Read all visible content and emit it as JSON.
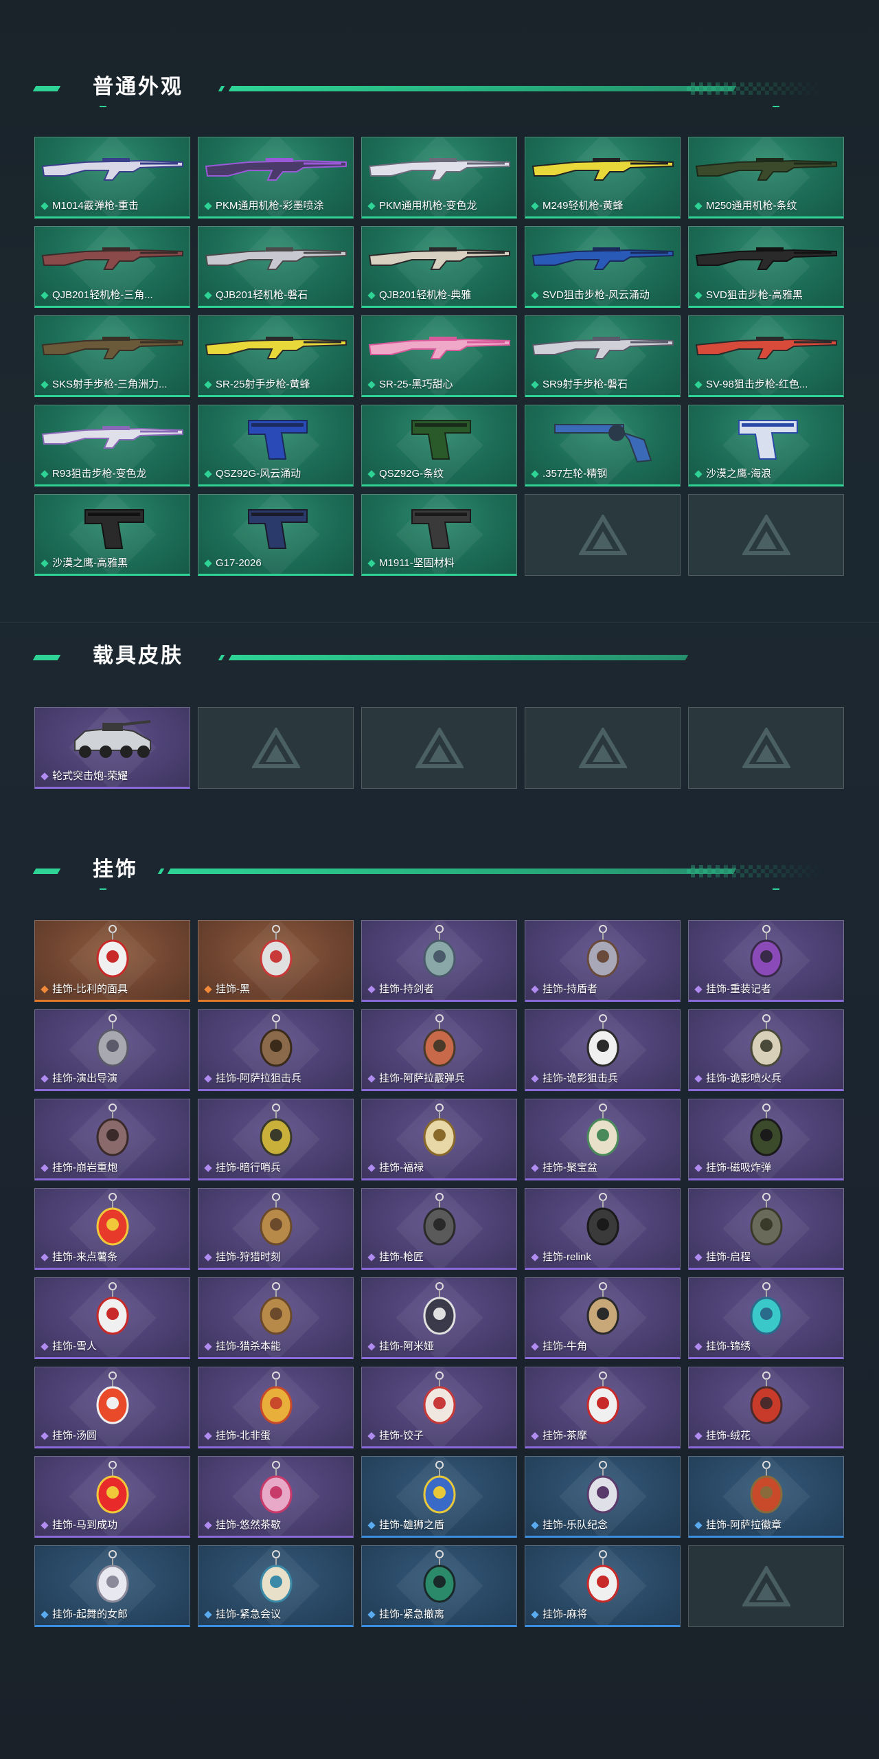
{
  "sections": [
    {
      "title": "普通外观",
      "items": [
        {
          "label": "M1014霰弹枪-重击",
          "rarity": "green",
          "kind": "rifle",
          "colors": [
            "#d8d8e8",
            "#3a3f8a"
          ]
        },
        {
          "label": "PKM通用机枪-彩墨喷涂",
          "rarity": "green",
          "kind": "rifle",
          "colors": [
            "#4a3a6a",
            "#9a5ad8"
          ]
        },
        {
          "label": "PKM通用机枪-变色龙",
          "rarity": "green",
          "kind": "rifle",
          "colors": [
            "#e0e0ea",
            "#6a6a7a"
          ]
        },
        {
          "label": "M249轻机枪-黄蜂",
          "rarity": "green",
          "kind": "rifle",
          "colors": [
            "#e8d83a",
            "#222222"
          ]
        },
        {
          "label": "M250通用机枪-条纹",
          "rarity": "green",
          "kind": "rifle",
          "colors": [
            "#3a4a2a",
            "#1e2a1a"
          ]
        },
        {
          "label": "QJB201轻机枪-三角...",
          "rarity": "green",
          "kind": "rifle",
          "colors": [
            "#8a4a4a",
            "#3a2a2a"
          ]
        },
        {
          "label": "QJB201轻机枪-磐石",
          "rarity": "green",
          "kind": "rifle",
          "colors": [
            "#c8c8d0",
            "#4a4a4a"
          ]
        },
        {
          "label": "QJB201轻机枪-典雅",
          "rarity": "green",
          "kind": "rifle",
          "colors": [
            "#d8d0c0",
            "#2a2a2a"
          ]
        },
        {
          "label": "SVD狙击步枪-风云涌动",
          "rarity": "green",
          "kind": "rifle",
          "colors": [
            "#2a5ab8",
            "#1a2a5a"
          ]
        },
        {
          "label": "SVD狙击步枪-高雅黑",
          "rarity": "green",
          "kind": "rifle",
          "colors": [
            "#2a2a2a",
            "#121212"
          ]
        },
        {
          "label": "SKS射手步枪-三角洲力...",
          "rarity": "green",
          "kind": "rifle",
          "colors": [
            "#6a5a3a",
            "#3a3026"
          ]
        },
        {
          "label": "SR-25射手步枪-黄蜂",
          "rarity": "green",
          "kind": "rifle",
          "colors": [
            "#e8d83a",
            "#2a2a2a"
          ]
        },
        {
          "label": "SR-25-黑巧甜心",
          "rarity": "green",
          "kind": "rifle",
          "colors": [
            "#f0a8c8",
            "#d85a9a"
          ]
        },
        {
          "label": "SR9射手步枪-磐石",
          "rarity": "green",
          "kind": "rifle",
          "colors": [
            "#d0d0d8",
            "#5a5a6a"
          ]
        },
        {
          "label": "SV-98狙击步枪-红色...",
          "rarity": "green",
          "kind": "rifle",
          "colors": [
            "#d84a3a",
            "#2a2a2a"
          ]
        },
        {
          "label": "R93狙击步枪-变色龙",
          "rarity": "green",
          "kind": "rifle",
          "colors": [
            "#e0e0ea",
            "#8a6ab8"
          ]
        },
        {
          "label": "QSZ92G-风云涌动",
          "rarity": "green",
          "kind": "pistol",
          "colors": [
            "#2a4ab8",
            "#1a2a5a"
          ]
        },
        {
          "label": "QSZ92G-条纹",
          "rarity": "green",
          "kind": "pistol",
          "colors": [
            "#2a5a2a",
            "#1a2a1a"
          ]
        },
        {
          "label": ".357左轮-精钢",
          "rarity": "green",
          "kind": "revolver",
          "colors": [
            "#3a6ab8",
            "#2a3a4a"
          ]
        },
        {
          "label": "沙漠之鹰-海浪",
          "rarity": "green",
          "kind": "pistol",
          "colors": [
            "#d8e0f0",
            "#2a4aa8"
          ]
        },
        {
          "label": "沙漠之鹰-高雅黑",
          "rarity": "green",
          "kind": "pistol",
          "colors": [
            "#2a2a2a",
            "#121212"
          ]
        },
        {
          "label": "G17-2026",
          "rarity": "green",
          "kind": "pistol",
          "colors": [
            "#2a3a6a",
            "#1a1a2a"
          ]
        },
        {
          "label": "M1911-坚固材料",
          "rarity": "green",
          "kind": "pistol",
          "colors": [
            "#3a3a3a",
            "#1a1a1a"
          ]
        },
        {
          "label": "",
          "rarity": "empty",
          "kind": "empty",
          "colors": []
        },
        {
          "label": "",
          "rarity": "empty",
          "kind": "empty",
          "colors": []
        }
      ]
    },
    {
      "title": "载具皮肤",
      "items": [
        {
          "label": "轮式突击炮-荣耀",
          "rarity": "purple",
          "kind": "vehicle",
          "colors": [
            "#d0d4d8",
            "#3a3a3a"
          ]
        },
        {
          "label": "",
          "rarity": "empty",
          "kind": "empty",
          "colors": []
        },
        {
          "label": "",
          "rarity": "empty",
          "kind": "empty",
          "colors": []
        },
        {
          "label": "",
          "rarity": "empty",
          "kind": "empty",
          "colors": []
        },
        {
          "label": "",
          "rarity": "empty",
          "kind": "empty",
          "colors": []
        }
      ]
    },
    {
      "title": "挂饰",
      "items": [
        {
          "label": "挂饰-比利的面具",
          "rarity": "orange",
          "kind": "charm",
          "colors": [
            "#f0f0f0",
            "#c82a2a"
          ]
        },
        {
          "label": "挂饰-黑",
          "rarity": "orange",
          "kind": "charm",
          "colors": [
            "#e0e0e0",
            "#c83a3a"
          ]
        },
        {
          "label": "挂饰-持剑者",
          "rarity": "purple",
          "kind": "charm",
          "colors": [
            "#8aa8a8",
            "#4a5a6a"
          ]
        },
        {
          "label": "挂饰-持盾者",
          "rarity": "purple",
          "kind": "charm",
          "colors": [
            "#a8a8b8",
            "#6a4a3a"
          ]
        },
        {
          "label": "挂饰-重装记者",
          "rarity": "purple",
          "kind": "charm",
          "colors": [
            "#8a4ab8",
            "#3a2a4a"
          ]
        },
        {
          "label": "挂饰-演出导演",
          "rarity": "purple",
          "kind": "charm",
          "colors": [
            "#a8a8b0",
            "#5a5a6a"
          ]
        },
        {
          "label": "挂饰-阿萨拉狙击兵",
          "rarity": "purple",
          "kind": "charm",
          "colors": [
            "#8a6a4a",
            "#3a2a1a"
          ]
        },
        {
          "label": "挂饰-阿萨拉霰弹兵",
          "rarity": "purple",
          "kind": "charm",
          "colors": [
            "#c86a4a",
            "#4a3a2a"
          ]
        },
        {
          "label": "挂饰-诡影狙击兵",
          "rarity": "purple",
          "kind": "charm",
          "colors": [
            "#f0f0f0",
            "#2a2a2a"
          ]
        },
        {
          "label": "挂饰-诡影喷火兵",
          "rarity": "purple",
          "kind": "charm",
          "colors": [
            "#d8d0b8",
            "#4a4a3a"
          ]
        },
        {
          "label": "挂饰-崩岩重炮",
          "rarity": "purple",
          "kind": "charm",
          "colors": [
            "#8a6a6a",
            "#3a2a2a"
          ]
        },
        {
          "label": "挂饰-暗行哨兵",
          "rarity": "purple",
          "kind": "charm",
          "colors": [
            "#c8b03a",
            "#3a3a2a"
          ]
        },
        {
          "label": "挂饰-福禄",
          "rarity": "purple",
          "kind": "charm",
          "colors": [
            "#e8d8a8",
            "#8a6a2a"
          ]
        },
        {
          "label": "挂饰-聚宝盆",
          "rarity": "purple",
          "kind": "charm",
          "colors": [
            "#e8e0c8",
            "#4a8a5a"
          ]
        },
        {
          "label": "挂饰-磁吸炸弹",
          "rarity": "purple",
          "kind": "charm",
          "colors": [
            "#3a4a2a",
            "#1a1a1a"
          ]
        },
        {
          "label": "挂饰-来点薯条",
          "rarity": "purple",
          "kind": "charm",
          "colors": [
            "#e83a2a",
            "#f0c83a"
          ]
        },
        {
          "label": "挂饰-狩猎时刻",
          "rarity": "purple",
          "kind": "charm",
          "colors": [
            "#b88a4a",
            "#6a4a2a"
          ]
        },
        {
          "label": "挂饰-枪匠",
          "rarity": "purple",
          "kind": "charm",
          "colors": [
            "#5a5a5a",
            "#2a2a2a"
          ]
        },
        {
          "label": "挂饰-relink",
          "rarity": "purple",
          "kind": "charm",
          "colors": [
            "#3a3a3a",
            "#1a1a1a"
          ]
        },
        {
          "label": "挂饰-启程",
          "rarity": "purple",
          "kind": "charm",
          "colors": [
            "#6a6a5a",
            "#3a3a2a"
          ]
        },
        {
          "label": "挂饰-雪人",
          "rarity": "purple",
          "kind": "charm",
          "colors": [
            "#f0f0f0",
            "#c82a2a"
          ]
        },
        {
          "label": "挂饰-猎杀本能",
          "rarity": "purple",
          "kind": "charm",
          "colors": [
            "#b88a4a",
            "#6a4a2a"
          ]
        },
        {
          "label": "挂饰-阿米娅",
          "rarity": "purple",
          "kind": "charm",
          "colors": [
            "#3a3a4a",
            "#e0e0e0"
          ]
        },
        {
          "label": "挂饰-牛角",
          "rarity": "purple",
          "kind": "charm",
          "colors": [
            "#c8a878",
            "#2a2a2a"
          ]
        },
        {
          "label": "挂饰-锦绣",
          "rarity": "purple",
          "kind": "charm",
          "colors": [
            "#3ac8c8",
            "#2a6a8a"
          ]
        },
        {
          "label": "挂饰-汤圆",
          "rarity": "purple",
          "kind": "charm",
          "colors": [
            "#e84a2a",
            "#f0f0f0"
          ]
        },
        {
          "label": "挂饰-北非蛋",
          "rarity": "purple",
          "kind": "charm",
          "colors": [
            "#e8b03a",
            "#c84a2a"
          ]
        },
        {
          "label": "挂饰-饺子",
          "rarity": "purple",
          "kind": "charm",
          "colors": [
            "#f0e8e0",
            "#c83a3a"
          ]
        },
        {
          "label": "挂饰-茶摩",
          "rarity": "purple",
          "kind": "charm",
          "colors": [
            "#f0f0f0",
            "#c82a2a"
          ]
        },
        {
          "label": "挂饰-绒花",
          "rarity": "purple",
          "kind": "charm",
          "colors": [
            "#c83a2a",
            "#4a2a2a"
          ]
        },
        {
          "label": "挂饰-马到成功",
          "rarity": "purple",
          "kind": "charm",
          "colors": [
            "#e82a2a",
            "#f0c83a"
          ]
        },
        {
          "label": "挂饰-悠然茶歇",
          "rarity": "purple",
          "kind": "charm",
          "colors": [
            "#e8a8c8",
            "#c83a6a"
          ]
        },
        {
          "label": "挂饰-雄狮之盾",
          "rarity": "blue",
          "kind": "charm",
          "colors": [
            "#3a6ac8",
            "#e8c83a"
          ]
        },
        {
          "label": "挂饰-乐队纪念",
          "rarity": "blue",
          "kind": "charm",
          "colors": [
            "#e0e0e8",
            "#5a3a6a"
          ]
        },
        {
          "label": "挂饰-阿萨拉徽章",
          "rarity": "blue",
          "kind": "charm",
          "colors": [
            "#c84a2a",
            "#8a6a3a"
          ]
        },
        {
          "label": "挂饰-起舞的女郎",
          "rarity": "blue",
          "kind": "charm",
          "colors": [
            "#e8e8f0",
            "#8a8a9a"
          ]
        },
        {
          "label": "挂饰-紧急会议",
          "rarity": "blue",
          "kind": "charm",
          "colors": [
            "#e8e0c8",
            "#3a8aa8"
          ]
        },
        {
          "label": "挂饰-紧急撤离",
          "rarity": "blue",
          "kind": "charm",
          "colors": [
            "#2a8a6a",
            "#1a2a2a"
          ]
        },
        {
          "label": "挂饰-麻将",
          "rarity": "blue",
          "kind": "charm",
          "colors": [
            "#f0f0f0",
            "#c82a2a"
          ]
        },
        {
          "label": "",
          "rarity": "empty",
          "kind": "empty",
          "colors": []
        }
      ]
    }
  ]
}
